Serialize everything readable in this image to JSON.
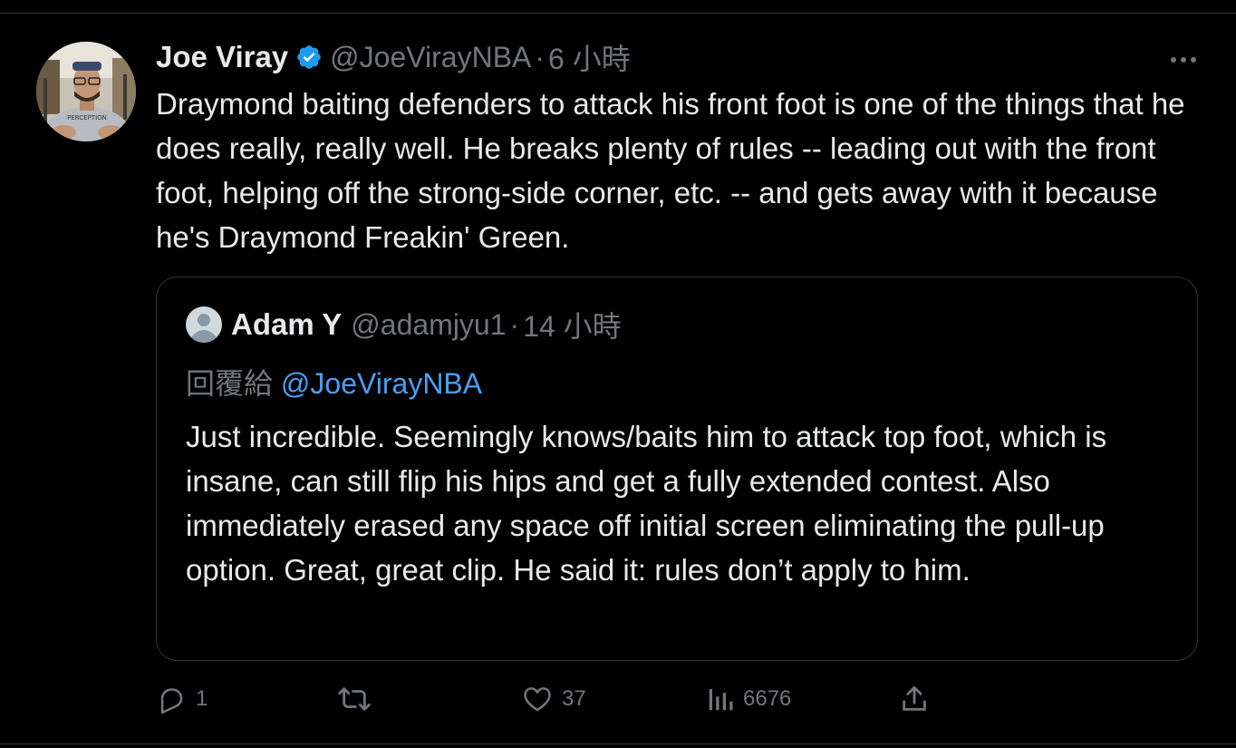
{
  "tweet": {
    "author_name": "Joe Viray",
    "handle": "@JoeVirayNBA",
    "separator": "·",
    "time": "6 小時",
    "text": "Draymond baiting defenders to attack his front foot is one of the things that he does really, really well. He breaks plenty of rules -- leading out with the front foot, helping off the strong-side corner, etc. -- and gets away with it because he's Draymond Freakin' Green.",
    "avatar_shirt_text": "PERCEPTION"
  },
  "quote": {
    "author_name": "Adam Y",
    "handle": "@adamjyu1",
    "separator": "·",
    "time": "14 小時",
    "reply_prefix": "回覆給",
    "reply_to": "@JoeVirayNBA",
    "text": "Just incredible. Seemingly knows/baits him to attack top foot, which is insane, can still flip his hips and get a fully extended contest. Also immediately erased any space off initial screen eliminating the pull-up option. Great, great clip. He said it: rules don’t apply to him."
  },
  "actions": {
    "replies": "1",
    "likes": "37",
    "views": "6676"
  },
  "icons": {
    "verified": "verified-badge-icon",
    "more": "more-options-icon",
    "reply": "reply-icon",
    "retweet": "retweet-icon",
    "like": "heart-icon",
    "views": "views-icon",
    "share": "share-icon"
  },
  "colors": {
    "background": "#000000",
    "text": "#e7e9ea",
    "muted": "#71767b",
    "accent": "#1d9bf0",
    "mention": "#4a9ff5",
    "border": "#2f3336"
  }
}
